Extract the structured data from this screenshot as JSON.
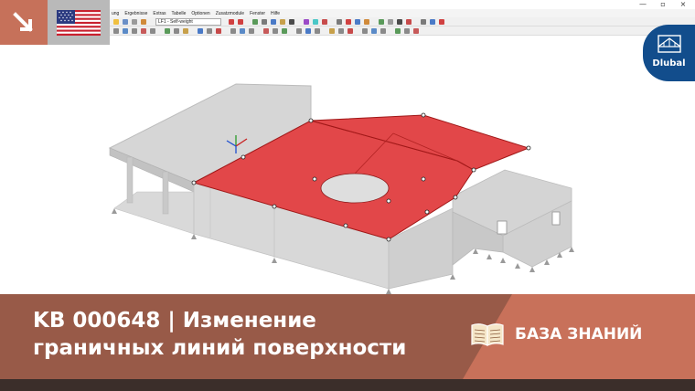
{
  "app": {
    "window_buttons": [
      "—",
      "▫",
      "×"
    ],
    "menu": [
      "ung",
      "Ergebnisse",
      "Extras",
      "Tabelle",
      "Optionen",
      "Zusatzmodule",
      "Fenster",
      "Hilfe"
    ],
    "load_case": "LF1 - Self-weight"
  },
  "badges": {
    "back_icon": "arrow-down-right-icon",
    "flag_icon": "us-flag-icon",
    "logo_name": "Dlubal",
    "logo_icon": "dlubal-bridge-logo-icon"
  },
  "banner": {
    "title_line1": "KB 000648 | Изменение",
    "title_line2": "граничных линий поверхности",
    "kb_label": "БАЗА ЗНАНИЙ",
    "book_icon": "open-book-icon"
  },
  "colors": {
    "accent_terracotta": "#c6715a",
    "banner_dark": "#985a48",
    "banner_light": "#c8715a",
    "selected_surface": "#e0393b",
    "dlubal_blue": "#124d8c",
    "model_grey": "#d3d3d3"
  }
}
